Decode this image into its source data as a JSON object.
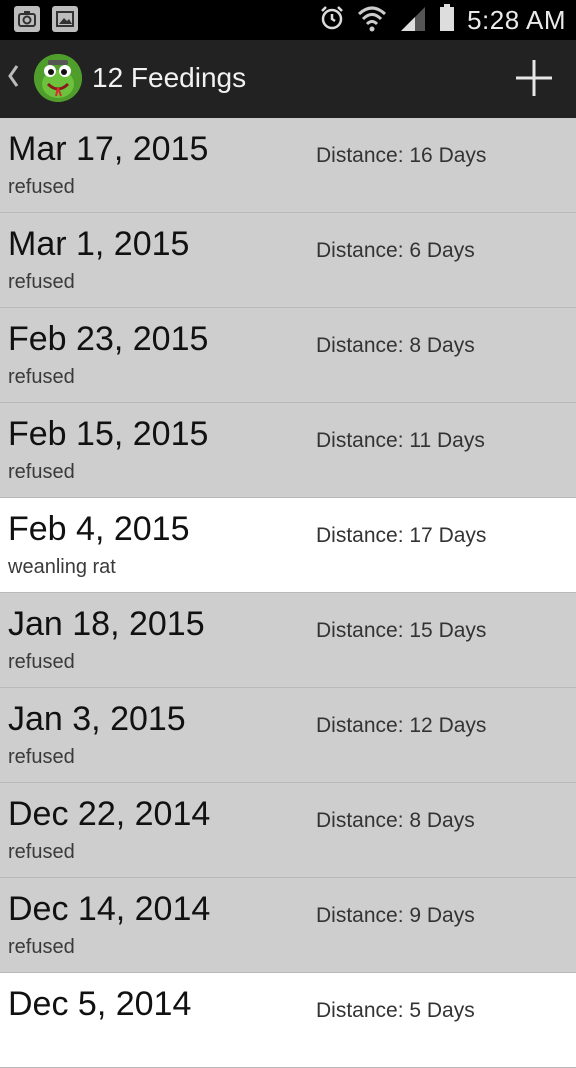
{
  "status": {
    "time": "5:28 AM"
  },
  "header": {
    "title": "12 Feedings"
  },
  "feedings": [
    {
      "date": "Mar 17, 2015",
      "note": "refused",
      "distance": "Distance: 16 Days"
    },
    {
      "date": "Mar 1, 2015",
      "note": "refused",
      "distance": "Distance: 6 Days"
    },
    {
      "date": "Feb 23, 2015",
      "note": "refused",
      "distance": "Distance: 8 Days"
    },
    {
      "date": "Feb 15, 2015",
      "note": "refused",
      "distance": "Distance: 11 Days"
    },
    {
      "date": "Feb 4, 2015",
      "note": "weanling rat",
      "distance": "Distance: 17 Days"
    },
    {
      "date": "Jan 18, 2015",
      "note": "refused",
      "distance": "Distance: 15 Days"
    },
    {
      "date": "Jan 3, 2015",
      "note": "refused",
      "distance": "Distance: 12 Days"
    },
    {
      "date": "Dec 22, 2014",
      "note": "refused",
      "distance": "Distance: 8 Days"
    },
    {
      "date": "Dec 14, 2014",
      "note": "refused",
      "distance": "Distance: 9 Days"
    },
    {
      "date": "Dec 5, 2014",
      "note": "",
      "distance": "Distance: 5 Days"
    }
  ],
  "icons": {
    "status_left": [
      "screenshot-icon",
      "gallery-icon"
    ],
    "status_right": [
      "alarm-icon",
      "wifi-icon",
      "signal-icon",
      "battery-icon"
    ],
    "header": [
      "back-chevron-icon",
      "avatar",
      "add-icon"
    ]
  }
}
